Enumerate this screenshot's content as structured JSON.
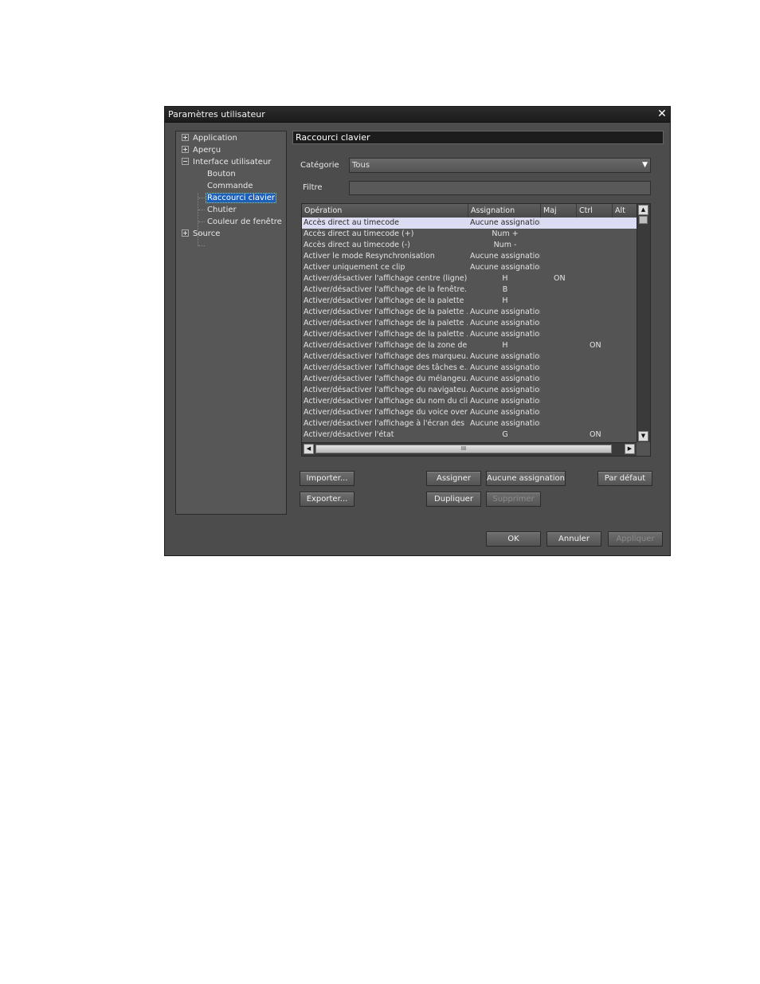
{
  "window": {
    "title": "Paramètres utilisateur",
    "close_glyph": "✕"
  },
  "tree": {
    "items": [
      {
        "label": "Application",
        "expander": "plus"
      },
      {
        "label": "Aperçu",
        "expander": "plus"
      },
      {
        "label": "Interface utilisateur",
        "expander": "minus"
      },
      {
        "label": "Bouton"
      },
      {
        "label": "Commande"
      },
      {
        "label": "Raccourci clavier",
        "selected": true
      },
      {
        "label": "Chutier"
      },
      {
        "label": "Couleur de fenêtre"
      },
      {
        "label": "Source",
        "expander": "plus"
      }
    ]
  },
  "panel": {
    "header": "Raccourci clavier",
    "category_label": "Catégorie",
    "category_value": "Tous",
    "filter_label": "Filtre",
    "filter_value": ""
  },
  "table": {
    "columns": [
      "Opération",
      "Assignation",
      "Maj",
      "Ctrl",
      "Alt"
    ],
    "rows": [
      [
        "Accès direct au timecode",
        "Aucune assignation",
        "",
        "",
        ""
      ],
      [
        "Accès direct au timecode (+)",
        "Num +",
        "",
        "",
        ""
      ],
      [
        "Accès direct au timecode (-)",
        "Num -",
        "",
        "",
        ""
      ],
      [
        "Activer le mode Resynchronisation",
        "Aucune assignation",
        "",
        "",
        ""
      ],
      [
        "Activer uniquement ce clip",
        "Aucune assignation",
        "",
        "",
        ""
      ],
      [
        "Activer/désactiver l'affichage centre (ligne)",
        "H",
        "ON",
        "",
        ""
      ],
      [
        "Activer/désactiver l'affichage de la fenêtre...",
        "B",
        "",
        "",
        ""
      ],
      [
        "Activer/désactiver l'affichage de la palette",
        "H",
        "",
        "",
        ""
      ],
      [
        "Activer/désactiver l'affichage de la palette ...",
        "Aucune assignation",
        "",
        "",
        ""
      ],
      [
        "Activer/désactiver l'affichage de la palette ...",
        "Aucune assignation",
        "",
        "",
        ""
      ],
      [
        "Activer/désactiver l'affichage de la palette ...",
        "Aucune assignation",
        "",
        "",
        ""
      ],
      [
        "Activer/désactiver l'affichage de la zone de...",
        "H",
        "",
        "ON",
        ""
      ],
      [
        "Activer/désactiver l'affichage des marqueu...",
        "Aucune assignation",
        "",
        "",
        ""
      ],
      [
        "Activer/désactiver l'affichage des tâches e...",
        "Aucune assignation",
        "",
        "",
        ""
      ],
      [
        "Activer/désactiver l'affichage du mélangeu...",
        "Aucune assignation",
        "",
        "",
        ""
      ],
      [
        "Activer/désactiver l'affichage du navigateu...",
        "Aucune assignation",
        "",
        "",
        ""
      ],
      [
        "Activer/désactiver l'affichage du nom du cli...",
        "Aucune assignation",
        "",
        "",
        ""
      ],
      [
        "Activer/désactiver l'affichage du voice over",
        "Aucune assignation",
        "",
        "",
        ""
      ],
      [
        "Activer/désactiver l'affichage à l'écran des ...",
        "Aucune assignation",
        "",
        "",
        ""
      ],
      [
        "Activer/désactiver l'état",
        "G",
        "",
        "ON",
        ""
      ]
    ],
    "scroll_up": "▲",
    "scroll_down": "▼",
    "scroll_left": "◀",
    "scroll_right": "▶",
    "scroll_grip": "III"
  },
  "buttons": {
    "import": "Importer...",
    "export": "Exporter...",
    "assign": "Assigner",
    "no_assign": "Aucune assignation",
    "duplicate": "Dupliquer",
    "delete": "Supprimer",
    "default": "Par défaut",
    "ok": "OK",
    "cancel": "Annuler",
    "apply": "Appliquer"
  }
}
